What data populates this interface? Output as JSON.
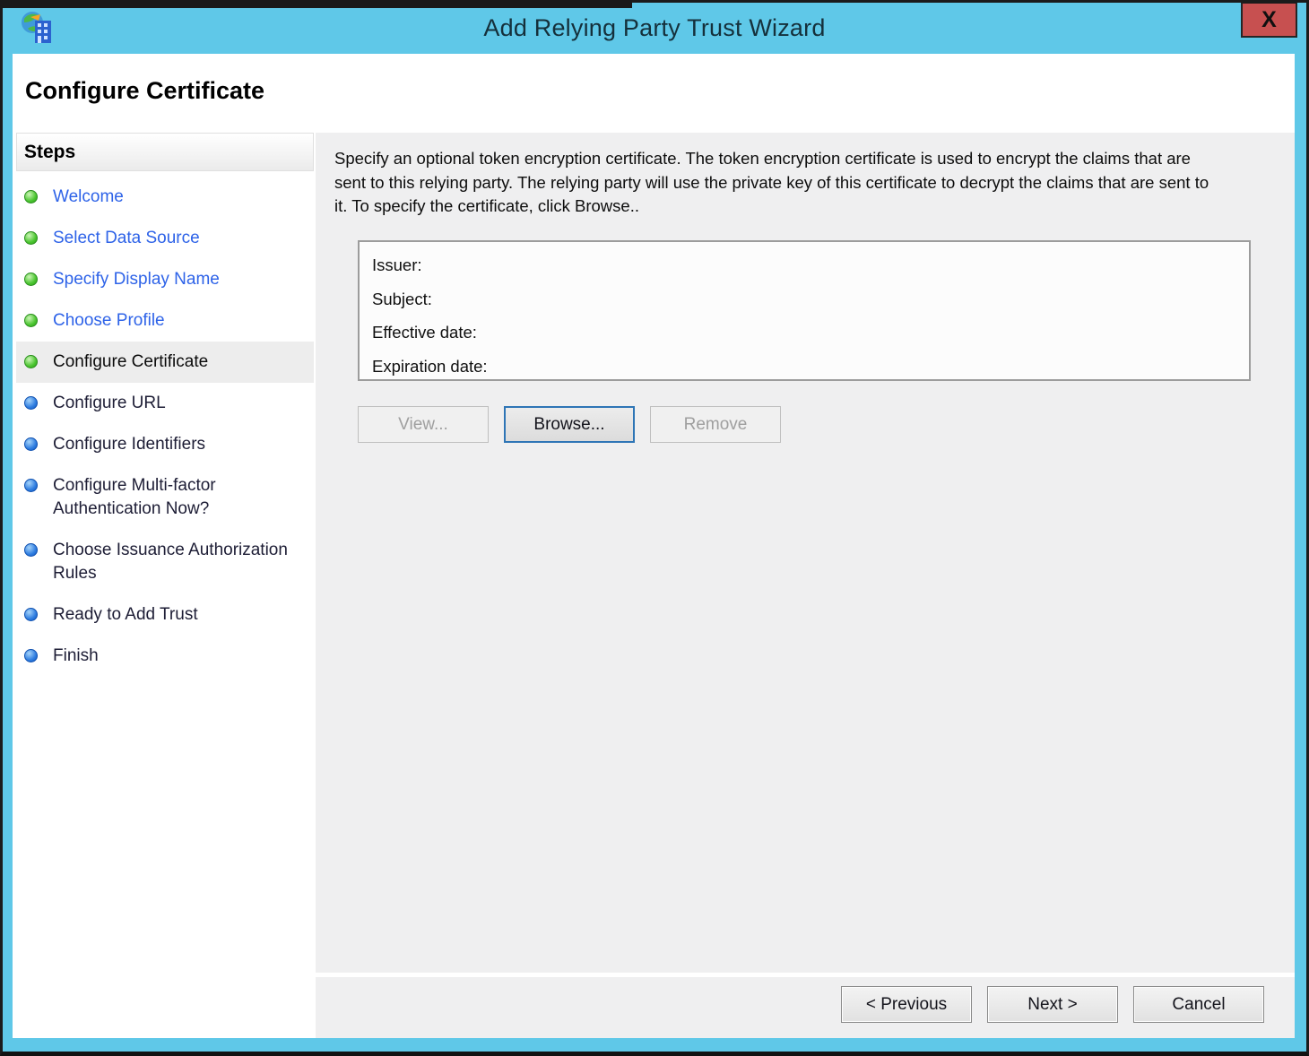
{
  "window": {
    "title": "Add Relying Party Trust Wizard",
    "close_label": "X"
  },
  "header": {
    "title": "Configure Certificate"
  },
  "sidebar": {
    "title": "Steps",
    "items": [
      {
        "label": "Welcome",
        "state": "done"
      },
      {
        "label": "Select Data Source",
        "state": "done"
      },
      {
        "label": "Specify Display Name",
        "state": "done"
      },
      {
        "label": "Choose Profile",
        "state": "done"
      },
      {
        "label": "Configure Certificate",
        "state": "current"
      },
      {
        "label": "Configure URL",
        "state": "upcoming"
      },
      {
        "label": "Configure Identifiers",
        "state": "upcoming"
      },
      {
        "label": "Configure Multi-factor Authentication Now?",
        "state": "upcoming"
      },
      {
        "label": "Choose Issuance Authorization Rules",
        "state": "upcoming"
      },
      {
        "label": "Ready to Add Trust",
        "state": "upcoming"
      },
      {
        "label": "Finish",
        "state": "upcoming"
      }
    ]
  },
  "main": {
    "description": "Specify an optional token encryption certificate.  The token encryption certificate is used to encrypt the claims that are sent to this relying party.  The relying party will use the private key of this certificate to decrypt the claims that are sent to it.  To specify the certificate, click Browse..",
    "certificate_fields": [
      {
        "label": "Issuer:",
        "value": ""
      },
      {
        "label": "Subject:",
        "value": ""
      },
      {
        "label": "Effective date:",
        "value": ""
      },
      {
        "label": "Expiration date:",
        "value": ""
      }
    ],
    "action_buttons": [
      {
        "label": "View...",
        "enabled": false,
        "focused": false
      },
      {
        "label": "Browse...",
        "enabled": true,
        "focused": true
      },
      {
        "label": "Remove",
        "enabled": false,
        "focused": false
      }
    ]
  },
  "footer": {
    "buttons": [
      {
        "label": "< Previous"
      },
      {
        "label": "Next >"
      },
      {
        "label": "Cancel"
      }
    ]
  },
  "colors": {
    "titlebar": "#5FC8E8",
    "close_button": "#C75050",
    "completed_link": "#2E63E8",
    "pane_background": "#EFEFF0",
    "done_bullet": "#3DB82E",
    "upcoming_bullet": "#1E6FD8"
  }
}
